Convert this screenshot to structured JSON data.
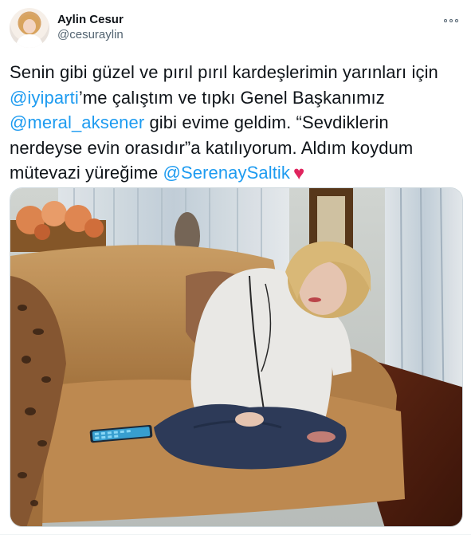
{
  "tweet": {
    "author": {
      "display_name": "Aylin Cesur",
      "handle": "@cesuraylin"
    },
    "text": {
      "line1": "Senin gibi güzel ve pırıl pırıl kardeşlerimin yarınları için",
      "mention1": "@iyiparti",
      "line2_rest": "’me çalıştım ve tıpkı Genel Başkanımız",
      "mention2": "@meral_aksener",
      "line3_rest": " gibi evime geldim. “Sevdiklerin",
      "line4": "nerdeyse evin orasıdır”a katılıyorum. Aldım koydum",
      "line5_start": "mütevazi yüreğime ",
      "mention3": "@SerenaySaltik",
      "heart": "♥"
    },
    "icons": {
      "more": "more-options-icon",
      "heart_color": "#e0245e",
      "mention_color": "#1d9bf0"
    }
  }
}
